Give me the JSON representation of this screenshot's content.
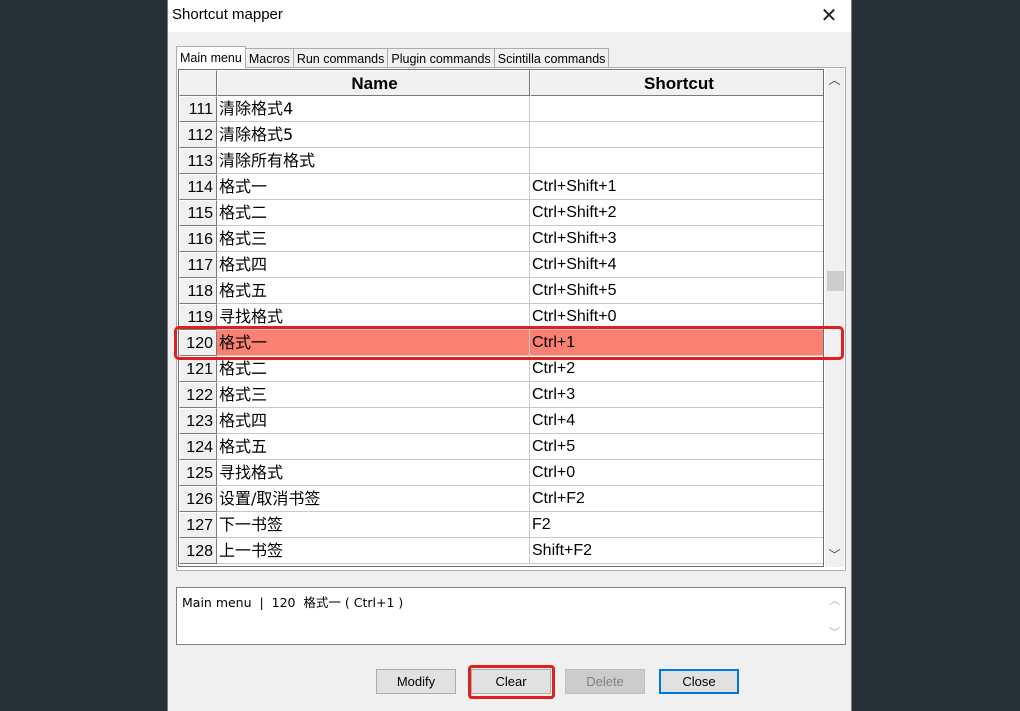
{
  "window": {
    "title": "Shortcut mapper"
  },
  "tabs": [
    "Main menu",
    "Macros",
    "Run commands",
    "Plugin commands",
    "Scintilla commands"
  ],
  "table": {
    "headers": {
      "name": "Name",
      "shortcut": "Shortcut"
    },
    "rows": [
      {
        "num": "111",
        "name": "清除格式4",
        "shortcut": ""
      },
      {
        "num": "112",
        "name": "清除格式5",
        "shortcut": ""
      },
      {
        "num": "113",
        "name": "清除所有格式",
        "shortcut": ""
      },
      {
        "num": "114",
        "name": "格式一",
        "shortcut": "Ctrl+Shift+1"
      },
      {
        "num": "115",
        "name": "格式二",
        "shortcut": "Ctrl+Shift+2"
      },
      {
        "num": "116",
        "name": "格式三",
        "shortcut": "Ctrl+Shift+3"
      },
      {
        "num": "117",
        "name": "格式四",
        "shortcut": "Ctrl+Shift+4"
      },
      {
        "num": "118",
        "name": "格式五",
        "shortcut": "Ctrl+Shift+5"
      },
      {
        "num": "119",
        "name": "寻找格式",
        "shortcut": "Ctrl+Shift+0"
      },
      {
        "num": "120",
        "name": "格式一",
        "shortcut": "Ctrl+1",
        "selected": true
      },
      {
        "num": "121",
        "name": "格式二",
        "shortcut": "Ctrl+2"
      },
      {
        "num": "122",
        "name": "格式三",
        "shortcut": "Ctrl+3"
      },
      {
        "num": "123",
        "name": "格式四",
        "shortcut": "Ctrl+4"
      },
      {
        "num": "124",
        "name": "格式五",
        "shortcut": "Ctrl+5"
      },
      {
        "num": "125",
        "name": "寻找格式",
        "shortcut": "Ctrl+0"
      },
      {
        "num": "126",
        "name": "设置/取消书签",
        "shortcut": "Ctrl+F2"
      },
      {
        "num": "127",
        "name": "下一书签",
        "shortcut": "F2"
      },
      {
        "num": "128",
        "name": "上一书签",
        "shortcut": "Shift+F2"
      }
    ]
  },
  "info": {
    "text": "Main menu  |  120  格式一 ( Ctrl+1 )"
  },
  "buttons": {
    "modify": "Modify",
    "clear": "Clear",
    "delete": "Delete",
    "close": "Close"
  },
  "icons": {
    "close": "close-icon",
    "scroll_up": "chevron-up-icon",
    "scroll_down": "chevron-down-icon"
  },
  "colors": {
    "selected_row": "#fa8072",
    "annotation": "#e0201c",
    "default_button_border": "#0078d7"
  }
}
